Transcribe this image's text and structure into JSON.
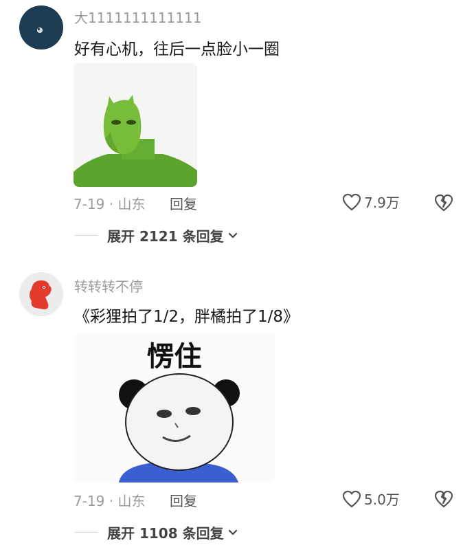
{
  "comments": [
    {
      "username": "大1111111111111",
      "text": "好有心机，往后一点脸小一圈",
      "date_location": "7-19 · 山东",
      "reply_label": "回复",
      "likes": "7.9万",
      "expand_label": "展开 2121 条回复",
      "avatar_colors": [
        "#1f3d52",
        "#d8dde2"
      ],
      "image_icon": "green-masked-figure"
    },
    {
      "username": "转转转不停",
      "text": "《彩狸拍了1/2，胖橘拍了1/8》",
      "date_location": "7-19 · 山东",
      "reply_label": "回复",
      "likes": "5.0万",
      "expand_label": "展开 1108 条回复",
      "image_caption": "愣住",
      "avatar_colors": [
        "#e8e8e8",
        "#e23a2c"
      ],
      "image_icon": "panda-meme"
    }
  ]
}
